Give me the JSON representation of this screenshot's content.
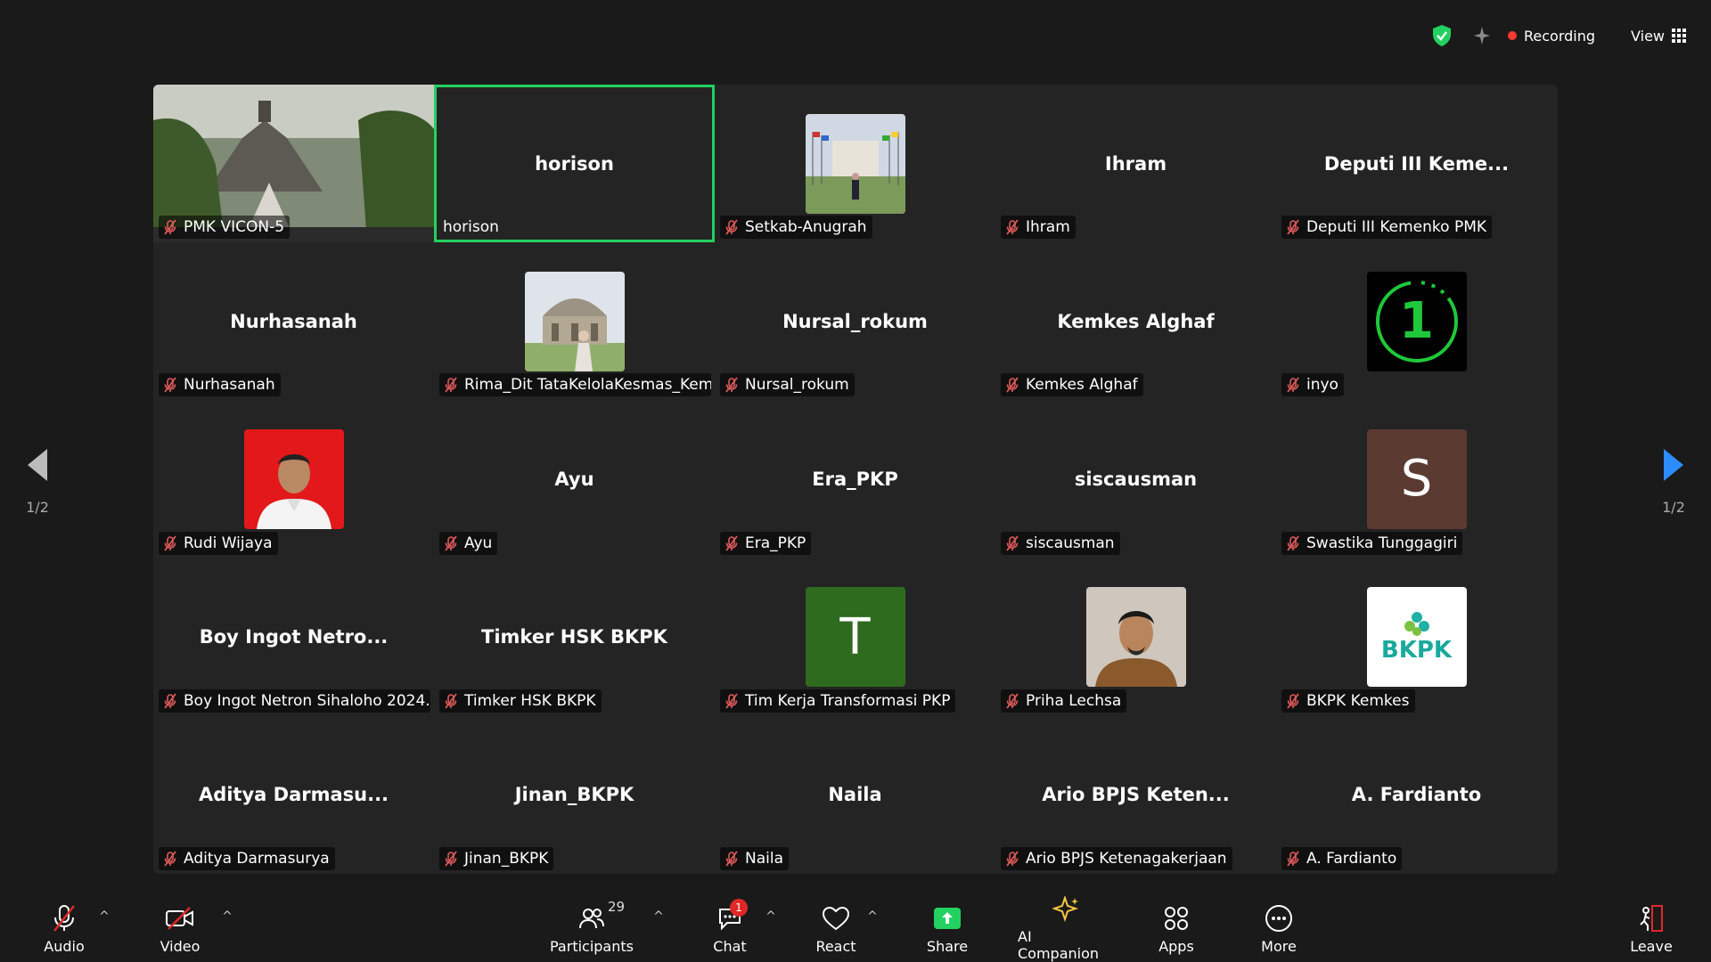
{
  "topbar": {
    "recording_label": "Recording",
    "view_label": "View"
  },
  "gallery": {
    "active_speaker_color": "#23d160",
    "tiles": [
      {
        "id": "r1c1",
        "big": "",
        "label": "PMK VICON-5",
        "kind": "photo-landscape"
      },
      {
        "id": "r1c2",
        "big": "horison",
        "label": "horison",
        "kind": "text",
        "active": true
      },
      {
        "id": "r1c3",
        "big": "",
        "label": "Setkab-Anugrah",
        "kind": "photo-flags"
      },
      {
        "id": "r1c4",
        "big": "Ihram",
        "label": "Ihram",
        "kind": "text"
      },
      {
        "id": "r1c5",
        "big": "Deputi III Keme...",
        "label": "Deputi III Kemenko PMK",
        "kind": "text"
      },
      {
        "id": "r2c1",
        "big": "Nurhasanah",
        "label": "Nurhasanah",
        "kind": "text"
      },
      {
        "id": "r2c2",
        "big": "",
        "label": "Rima_Dit TataKelolaKesmas_Kem...",
        "kind": "photo-building"
      },
      {
        "id": "r2c3",
        "big": "Nursal_rokum",
        "label": "Nursal_rokum",
        "kind": "text"
      },
      {
        "id": "r2c4",
        "big": "Kemkes Alghaf",
        "label": "Kemkes Alghaf",
        "kind": "text"
      },
      {
        "id": "r2c5",
        "big": "",
        "label": "inyo",
        "kind": "avatar-one",
        "letter": "1"
      },
      {
        "id": "r3c1",
        "big": "",
        "label": "Rudi Wijaya",
        "kind": "photo-portrait-red"
      },
      {
        "id": "r3c2",
        "big": "Ayu",
        "label": "Ayu",
        "kind": "text"
      },
      {
        "id": "r3c3",
        "big": "Era_PKP",
        "label": "Era_PKP",
        "kind": "text"
      },
      {
        "id": "r3c4",
        "big": "siscausman",
        "label": "siscausman",
        "kind": "text"
      },
      {
        "id": "r3c5",
        "big": "",
        "label": "Swastika Tunggagiri",
        "kind": "avatar-letter",
        "letter": "S",
        "color": "#5b3a31"
      },
      {
        "id": "r4c1",
        "big": "Boy Ingot Netro...",
        "label": "Boy Ingot Netron Sihaloho 2024...",
        "kind": "text"
      },
      {
        "id": "r4c2",
        "big": "Timker HSK BKPK",
        "label": "Timker HSK BKPK",
        "kind": "text"
      },
      {
        "id": "r4c3",
        "big": "",
        "label": "Tim Kerja Transformasi PKP",
        "kind": "avatar-letter",
        "letter": "T",
        "color": "#2e6b1f"
      },
      {
        "id": "r4c4",
        "big": "",
        "label": "Priha Lechsa",
        "kind": "photo-portrait-brown"
      },
      {
        "id": "r4c5",
        "big": "",
        "label": "BKPK Kemkes",
        "kind": "logo-bkpk",
        "logo_text": "BKPK"
      },
      {
        "id": "r5c1",
        "big": "Aditya Darmasu...",
        "label": "Aditya Darmasurya",
        "kind": "text"
      },
      {
        "id": "r5c2",
        "big": "Jinan_BKPK",
        "label": "Jinan_BKPK",
        "kind": "text"
      },
      {
        "id": "r5c3",
        "big": "Naila",
        "label": "Naila",
        "kind": "text"
      },
      {
        "id": "r5c4",
        "big": "Ario BPJS Keten...",
        "label": "Ario BPJS Ketenagakerjaan",
        "kind": "text"
      },
      {
        "id": "r5c5",
        "big": "A. Fardianto",
        "label": "A. Fardianto",
        "kind": "text"
      }
    ]
  },
  "pager": {
    "left_label": "1/2",
    "right_label": "1/2"
  },
  "toolbar": {
    "audio_label": "Audio",
    "video_label": "Video",
    "participants_label": "Participants",
    "participants_count": "29",
    "chat_label": "Chat",
    "chat_badge": "1",
    "react_label": "React",
    "share_label": "Share",
    "share_color": "#23d160",
    "ai_label": "AI Companion",
    "apps_label": "Apps",
    "more_label": "More",
    "leave_label": "Leave",
    "leave_color": "#e02828"
  }
}
